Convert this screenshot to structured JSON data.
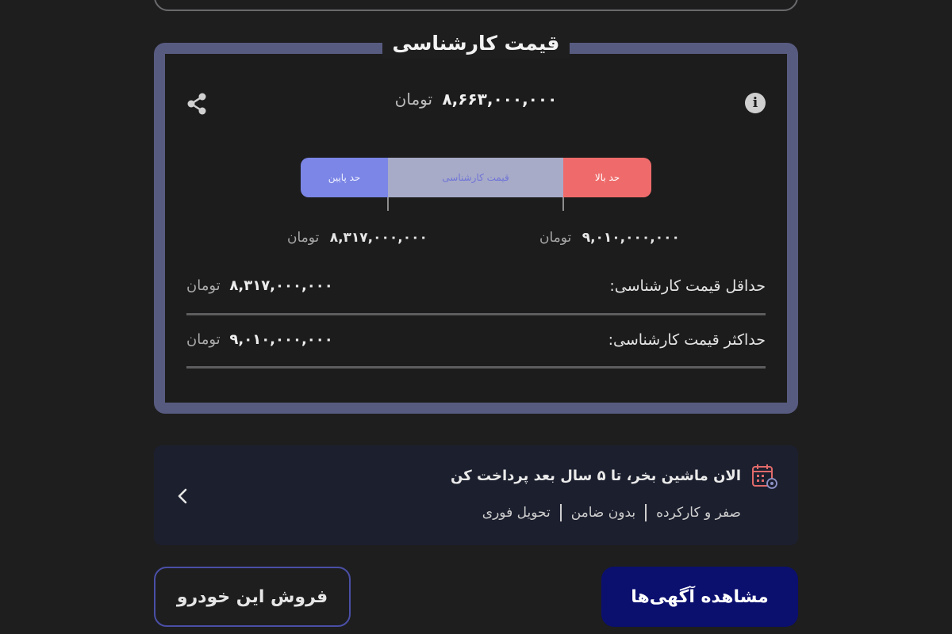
{
  "card": {
    "title": "قیمت کارشناسی",
    "main_price": "۸,۶۶۳,۰۰۰,۰۰۰",
    "currency": "تومان",
    "bar": {
      "low_label": "حد پایین",
      "mid_label": "قیمت کارشناسی",
      "high_label": "حد بالا",
      "colors": {
        "low": "#7c86e6",
        "mid": "#a7abc8",
        "high": "#ef6b6b"
      }
    },
    "range_min": "۸,۳۱۷,۰۰۰,۰۰۰",
    "range_max": "۹,۰۱۰,۰۰۰,۰۰۰",
    "rows": [
      {
        "label": "حداقل قیمت کارشناسی:",
        "value": "۸,۳۱۷,۰۰۰,۰۰۰",
        "unit": "تومان"
      },
      {
        "label": "حداکثر قیمت کارشناسی:",
        "value": "۹,۰۱۰,۰۰۰,۰۰۰",
        "unit": "تومان"
      }
    ],
    "icons": {
      "share": "share-icon",
      "info": "info-icon"
    }
  },
  "promo": {
    "title": "الان ماشین بخر، تا ۵ سال بعد پرداخت کن",
    "features": [
      "صفر و کارکرده",
      "بدون ضامن",
      "تحویل فوری"
    ],
    "icons": {
      "calendar": "calendar-icon",
      "chevron": "chevron-left-icon"
    }
  },
  "actions": {
    "view_ads": "مشاهده آگهی‌ها",
    "sell_car": "فروش این خودرو",
    "colors": {
      "primary": "#0b0f6e",
      "outline": "#4a4fa6"
    }
  }
}
